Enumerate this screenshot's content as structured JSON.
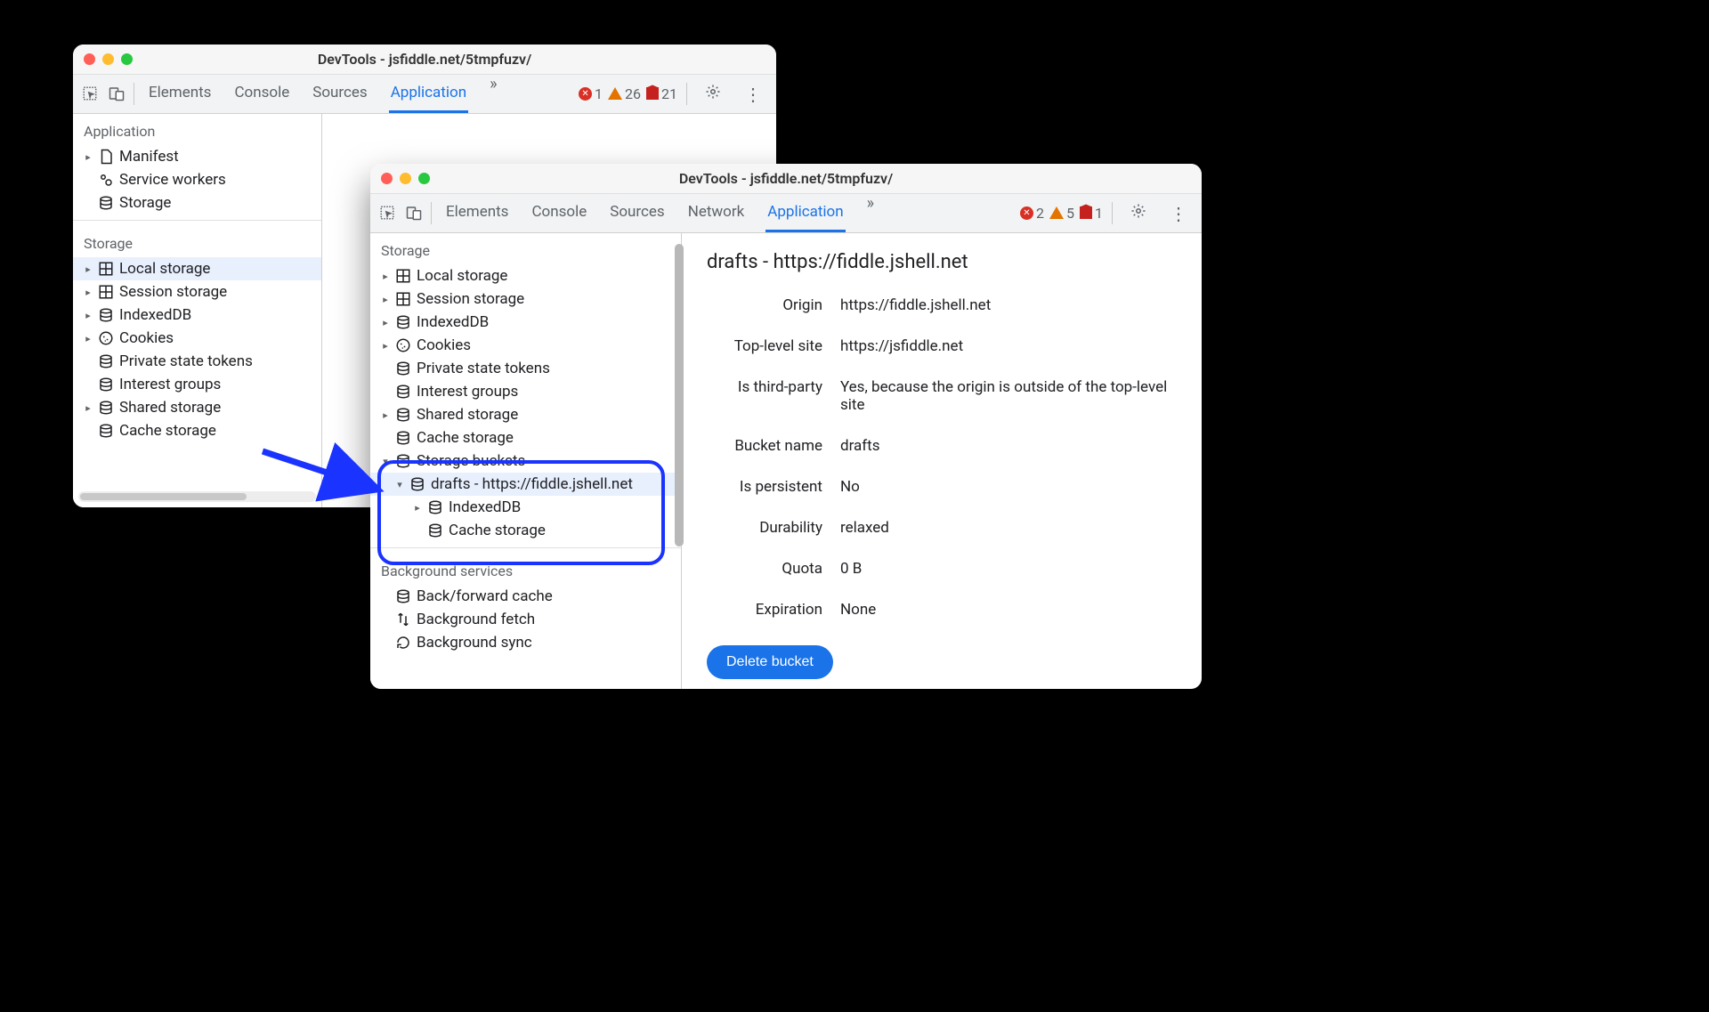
{
  "win1": {
    "title": "DevTools - jsfiddle.net/5tmpfuzv/",
    "tabs": [
      "Elements",
      "Console",
      "Sources",
      "Application"
    ],
    "activeTab": "Application",
    "errors": "1",
    "warnings": "26",
    "issues": "21",
    "section_app": "Application",
    "app_items": {
      "manifest": "Manifest",
      "sw": "Service workers",
      "storage": "Storage"
    },
    "section_storage": "Storage",
    "storage_items": {
      "local": "Local storage",
      "session": "Session storage",
      "idb": "IndexedDB",
      "cookies": "Cookies",
      "pst": "Private state tokens",
      "ig": "Interest groups",
      "shared": "Shared storage",
      "cache": "Cache storage"
    }
  },
  "win2": {
    "title": "DevTools - jsfiddle.net/5tmpfuzv/",
    "tabs": [
      "Elements",
      "Console",
      "Sources",
      "Network",
      "Application"
    ],
    "activeTab": "Application",
    "errors": "2",
    "warnings": "5",
    "issues": "1",
    "section_storage": "Storage",
    "storage_items": {
      "local": "Local storage",
      "session": "Session storage",
      "idb": "IndexedDB",
      "cookies": "Cookies",
      "pst": "Private state tokens",
      "ig": "Interest groups",
      "shared": "Shared storage",
      "cache": "Cache storage",
      "buckets": "Storage buckets",
      "bucket_drafts": "drafts - https://fiddle.jshell.net",
      "bucket_idb": "IndexedDB",
      "bucket_cache": "Cache storage"
    },
    "section_bg": "Background services",
    "bg_items": {
      "bfc": "Back/forward cache",
      "bgfetch": "Background fetch",
      "bgsync": "Background sync"
    },
    "detail_title": "drafts - https://fiddle.jshell.net",
    "detail": {
      "origin_k": "Origin",
      "origin_v": "https://fiddle.jshell.net",
      "tls_k": "Top-level site",
      "tls_v": "https://jsfiddle.net",
      "tp_k": "Is third-party",
      "tp_v": "Yes, because the origin is outside of the top-level site",
      "bn_k": "Bucket name",
      "bn_v": "drafts",
      "pers_k": "Is persistent",
      "pers_v": "No",
      "dur_k": "Durability",
      "dur_v": "relaxed",
      "quota_k": "Quota",
      "quota_v": "0 B",
      "exp_k": "Expiration",
      "exp_v": "None"
    },
    "delete_btn": "Delete bucket"
  }
}
